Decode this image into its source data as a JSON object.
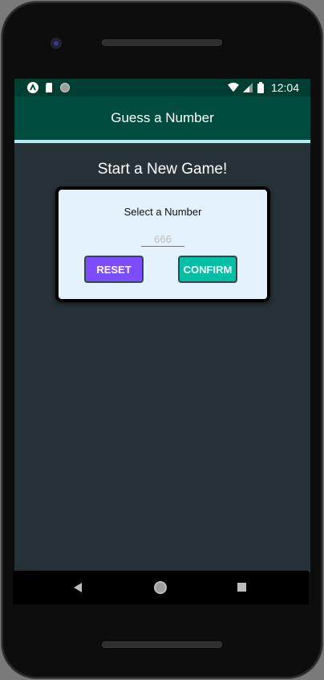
{
  "status_bar": {
    "time": "12:04",
    "left_icons": [
      "expo-icon",
      "sd-card-icon",
      "circle-icon"
    ],
    "right_icons": [
      "wifi-icon",
      "signal-icon",
      "battery-icon"
    ]
  },
  "app_bar": {
    "title": "Guess a Number"
  },
  "screen": {
    "heading": "Start a New Game!"
  },
  "card": {
    "label": "Select a Number",
    "input": {
      "value": "",
      "placeholder": "666"
    },
    "reset_label": "RESET",
    "confirm_label": "CONFIRM"
  },
  "colors": {
    "app_bar": "#004d40",
    "background": "#263238",
    "card": "#e3f2fd",
    "reset_button": "#7c4dff",
    "confirm_button": "#00bfa5"
  },
  "nav_bar": {
    "icons": [
      "back-icon",
      "home-icon",
      "recents-icon"
    ]
  }
}
